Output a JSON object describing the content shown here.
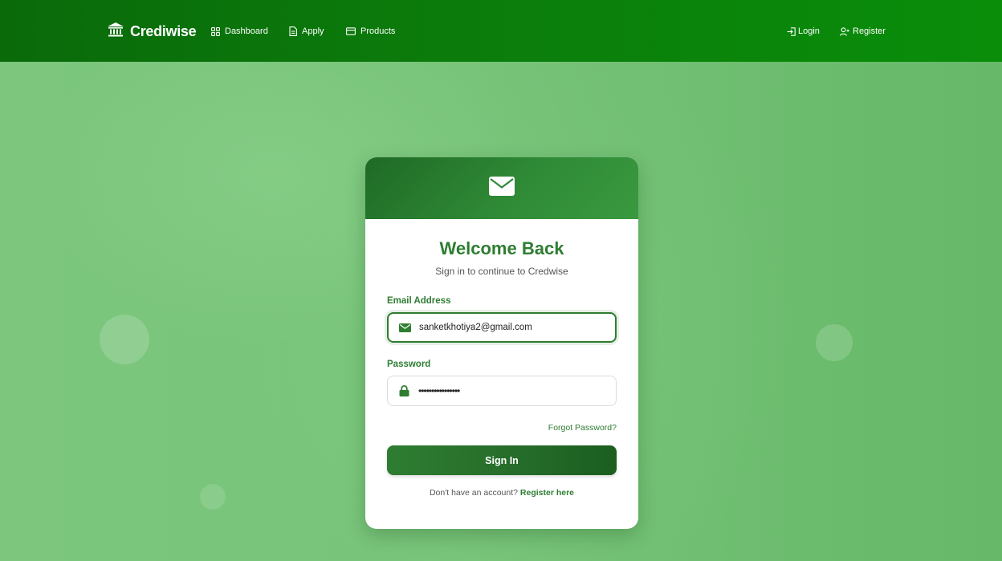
{
  "navbar": {
    "brand": {
      "name": "Crediwise",
      "icon": "bank-icon"
    },
    "links": [
      {
        "label": "Dashboard",
        "icon": "grid-icon"
      },
      {
        "label": "Apply",
        "icon": "document-icon"
      },
      {
        "label": "Products",
        "icon": "credit-card-icon"
      }
    ],
    "auth": {
      "login": {
        "label": "Login",
        "icon": "login-icon"
      },
      "register": {
        "label": "Register",
        "icon": "user-plus-icon"
      }
    }
  },
  "card": {
    "header_icon": "envelope-icon",
    "title": "Welcome Back",
    "subtitle": "Sign in to continue to Credwise",
    "email": {
      "label": "Email Address",
      "value": "sanketkhotiya2@gmail.com",
      "icon": "envelope-icon"
    },
    "password": {
      "label": "Password",
      "value": "••••••••••••••••",
      "icon": "lock-icon"
    },
    "forgot_password": "Forgot Password?",
    "submit_label": "Sign In",
    "register_prompt": "Don't have an account?",
    "register_link": "Register here"
  },
  "colors": {
    "navbar": "#0b7a0b",
    "accent": "#2e7d32",
    "background": "#72c074",
    "card": "#ffffff"
  }
}
